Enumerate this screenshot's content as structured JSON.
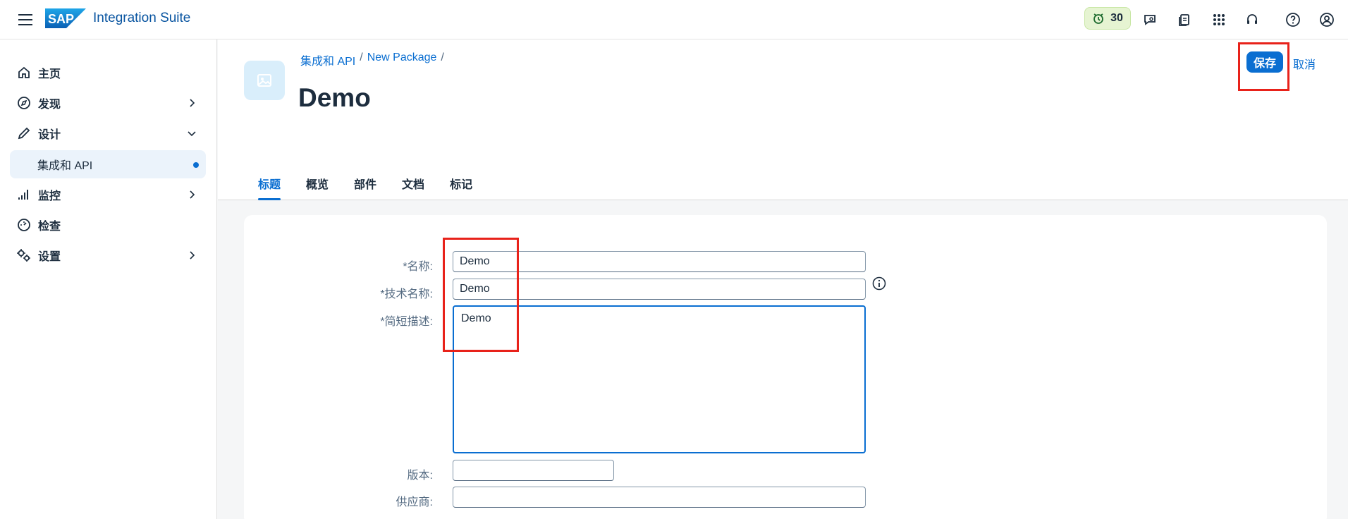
{
  "shell": {
    "product_name": "Integration Suite",
    "logo_text": "SAP",
    "notification_count": "30",
    "icons": [
      "menu-icon",
      "activity-icon",
      "feedback-icon",
      "documents-icon",
      "app-grid-icon",
      "headset-icon",
      "help-icon",
      "user-icon"
    ]
  },
  "sidebar": {
    "items": [
      {
        "label": "主页",
        "icon": "home-icon"
      },
      {
        "label": "发现",
        "icon": "compass-icon"
      },
      {
        "label": "设计",
        "icon": "pencil-icon"
      },
      {
        "label": "集成和 API"
      },
      {
        "label": "监控",
        "icon": "monitor-bars-icon"
      },
      {
        "label": "检查",
        "icon": "inspect-icon"
      },
      {
        "label": "设置",
        "icon": "gears-icon"
      }
    ]
  },
  "header": {
    "breadcrumb": [
      "集成和 API",
      "New Package"
    ],
    "separator": "/",
    "title": "Demo",
    "save_label": "保存",
    "cancel_label": "取消"
  },
  "tabs": [
    "标题",
    "概览",
    "部件",
    "文档",
    "标记"
  ],
  "form": {
    "name_label": "*名称:",
    "name_value": "Demo",
    "tech_name_label": "*技术名称:",
    "tech_name_value": "Demo",
    "short_desc_label": "*简短描述:",
    "short_desc_value": "Demo",
    "version_label": "版本:",
    "version_value": "",
    "vendor_label": "供应商:",
    "vendor_value": ""
  },
  "colors": {
    "accent": "#0a6ed1",
    "highlight": "#e8221a",
    "badge_bg": "#e6f4d2"
  }
}
